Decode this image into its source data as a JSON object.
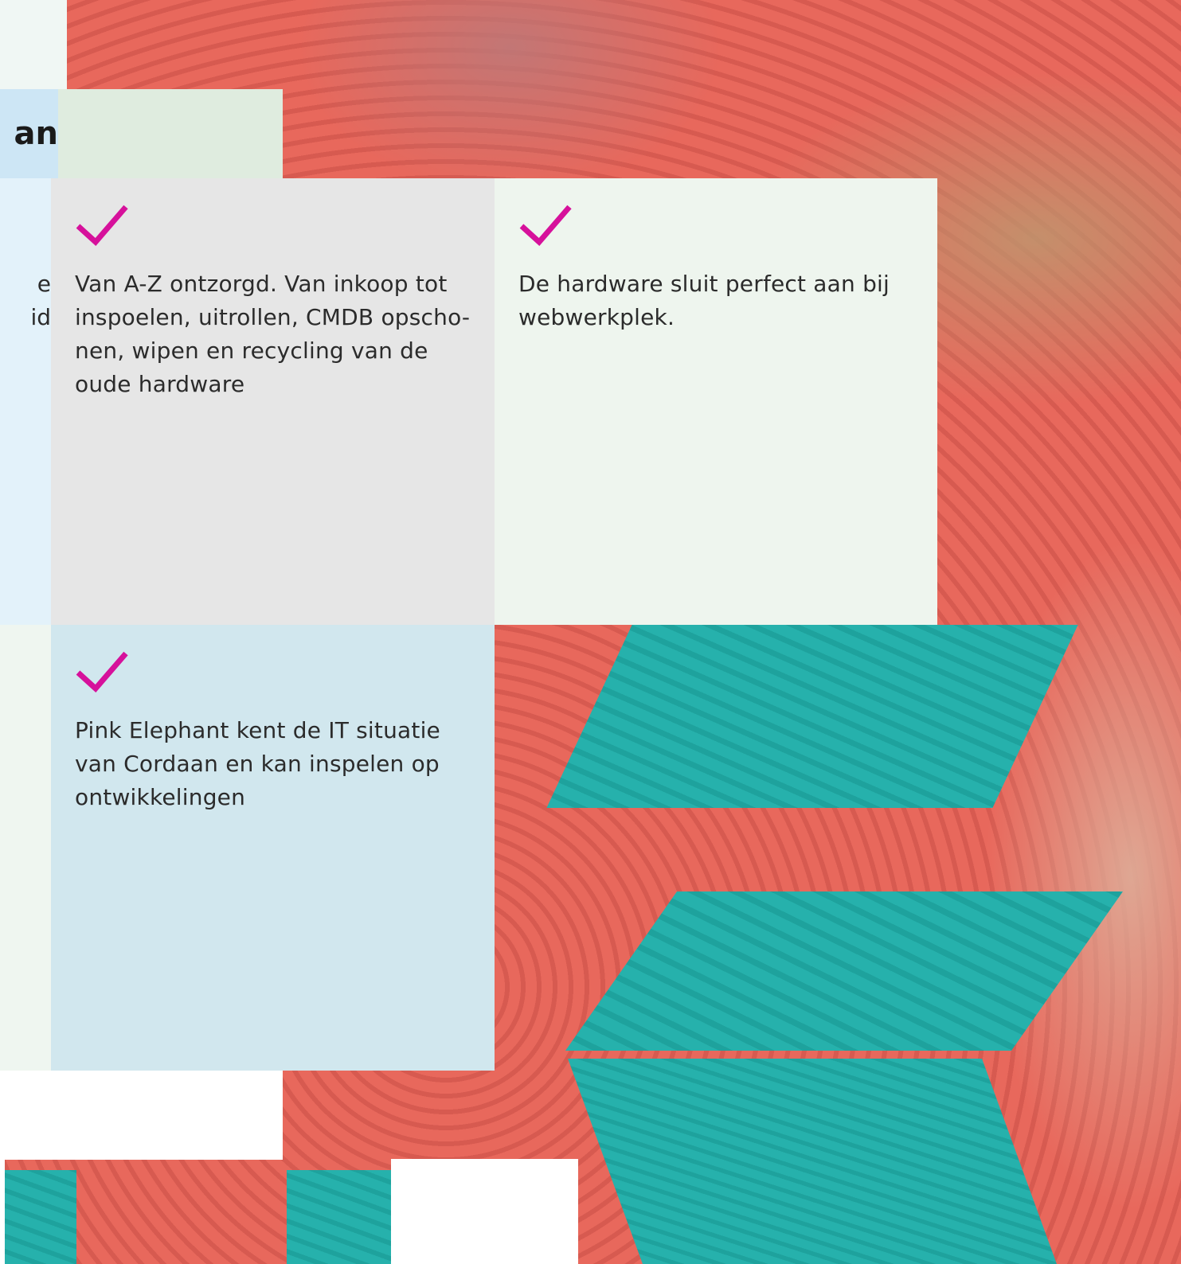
{
  "partial_heading": "an",
  "partial_left_text": [
    "e",
    "id"
  ],
  "benefits": [
    {
      "text": "Van A-Z ontzorgd. Van inkoop tot inspoelen, uitrollen, CMDB opscho-nen, wipen en recycling van de oude hardware"
    },
    {
      "text": "De hardware sluit perfect aan bij webwerkplek."
    },
    {
      "text": "Pink Elephant kent de IT situatie van Cordaan en kan inspelen op ontwikkelingen"
    }
  ],
  "colors": {
    "accent_check": "#d6119b",
    "card_grey": "#e6e6e6",
    "card_mint": "#eef5ee",
    "card_blue": "#d1e7ee",
    "left_blue": "#e3f2fa",
    "left_mint": "#eff6f0",
    "top_mint": "#dfecdf",
    "title_blue": "#cde6f5"
  }
}
